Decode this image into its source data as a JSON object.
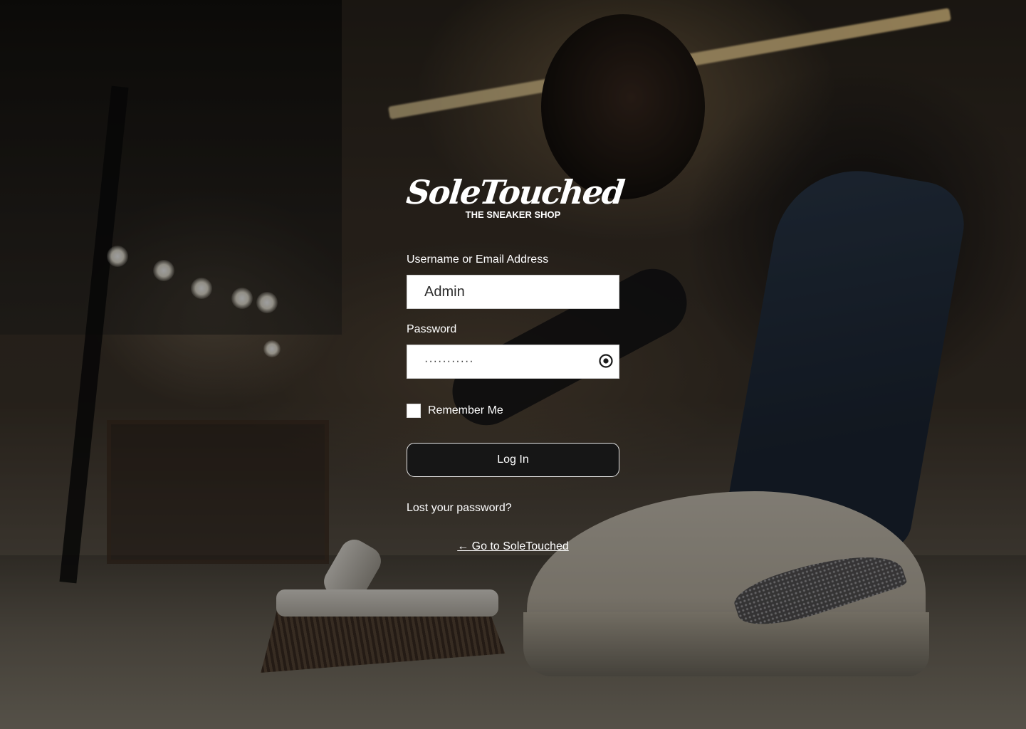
{
  "brand": {
    "logo_title": "SoleTouched",
    "logo_subtitle": "THE SNEAKER SHOP"
  },
  "form": {
    "username_label": "Username or Email Address",
    "username_value": "Admin",
    "password_label": "Password",
    "password_masked": "···········",
    "show_password_icon": "eye-icon",
    "remember_label": "Remember Me",
    "remember_checked": false,
    "login_button": "Log In"
  },
  "links": {
    "lost_password": "Lost your password?",
    "back_to_site": "← Go to SoleTouched"
  },
  "colors": {
    "button_bg": "#161616",
    "text": "#ffffff",
    "input_bg": "#ffffff"
  }
}
